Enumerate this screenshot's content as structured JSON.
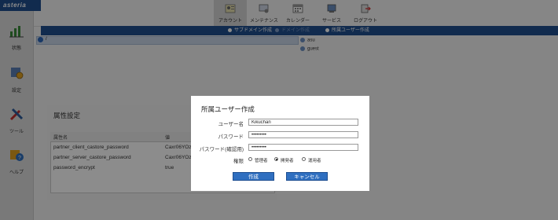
{
  "logo": {
    "text": "asteria"
  },
  "top_nav": [
    {
      "label": "アカウント",
      "icon": "account-icon",
      "active": true
    },
    {
      "label": "メンテナンス",
      "icon": "maintenance-icon"
    },
    {
      "label": "カレンダー",
      "icon": "calendar-icon"
    },
    {
      "label": "サービス",
      "icon": "service-icon"
    },
    {
      "label": "ログアウト",
      "icon": "logout-icon"
    }
  ],
  "sub_nav": [
    {
      "label": "サブドメイン作成",
      "disabled": false
    },
    {
      "label": "ドメイン作成",
      "disabled": true
    },
    {
      "label": "所属ユーザー作成",
      "disabled": false
    }
  ],
  "sidebar": [
    {
      "label": "状態",
      "icon": "status-chart-icon"
    },
    {
      "label": "設定",
      "icon": "settings-icon"
    },
    {
      "label": "ツール",
      "icon": "tools-icon"
    },
    {
      "label": "ヘルプ",
      "icon": "help-icon"
    }
  ],
  "tree": {
    "path": "/"
  },
  "users": [
    "asu",
    "guest"
  ],
  "attributes_panel": {
    "title": "属性設定",
    "headers": [
      "属性名",
      "値"
    ],
    "rows": [
      {
        "name": "partner_client_castore_password",
        "value": "Caxr06YOz"
      },
      {
        "name": "partner_server_castore_password",
        "value": "Caxr06YOz"
      },
      {
        "name": "password_encrypt",
        "value": "true"
      }
    ]
  },
  "dialog": {
    "title": "所属ユーザー作成",
    "username_label": "ユーザー名",
    "username_value": "Kikuchan",
    "password_label": "パスワード",
    "password_value": "•••••••••",
    "password_confirm_label": "パスワード(確認用)",
    "password_confirm_value": "•••••••••",
    "role_label": "権限",
    "roles": [
      {
        "label": "管理者",
        "checked": false
      },
      {
        "label": "開発者",
        "checked": true
      },
      {
        "label": "運用者",
        "checked": false
      }
    ],
    "create_label": "作成",
    "cancel_label": "キャンセル"
  },
  "colors": {
    "brand_blue": "#1f4f8f",
    "button_blue": "#2f6fc0",
    "overlay": "rgba(0,0,0,0.45)"
  }
}
